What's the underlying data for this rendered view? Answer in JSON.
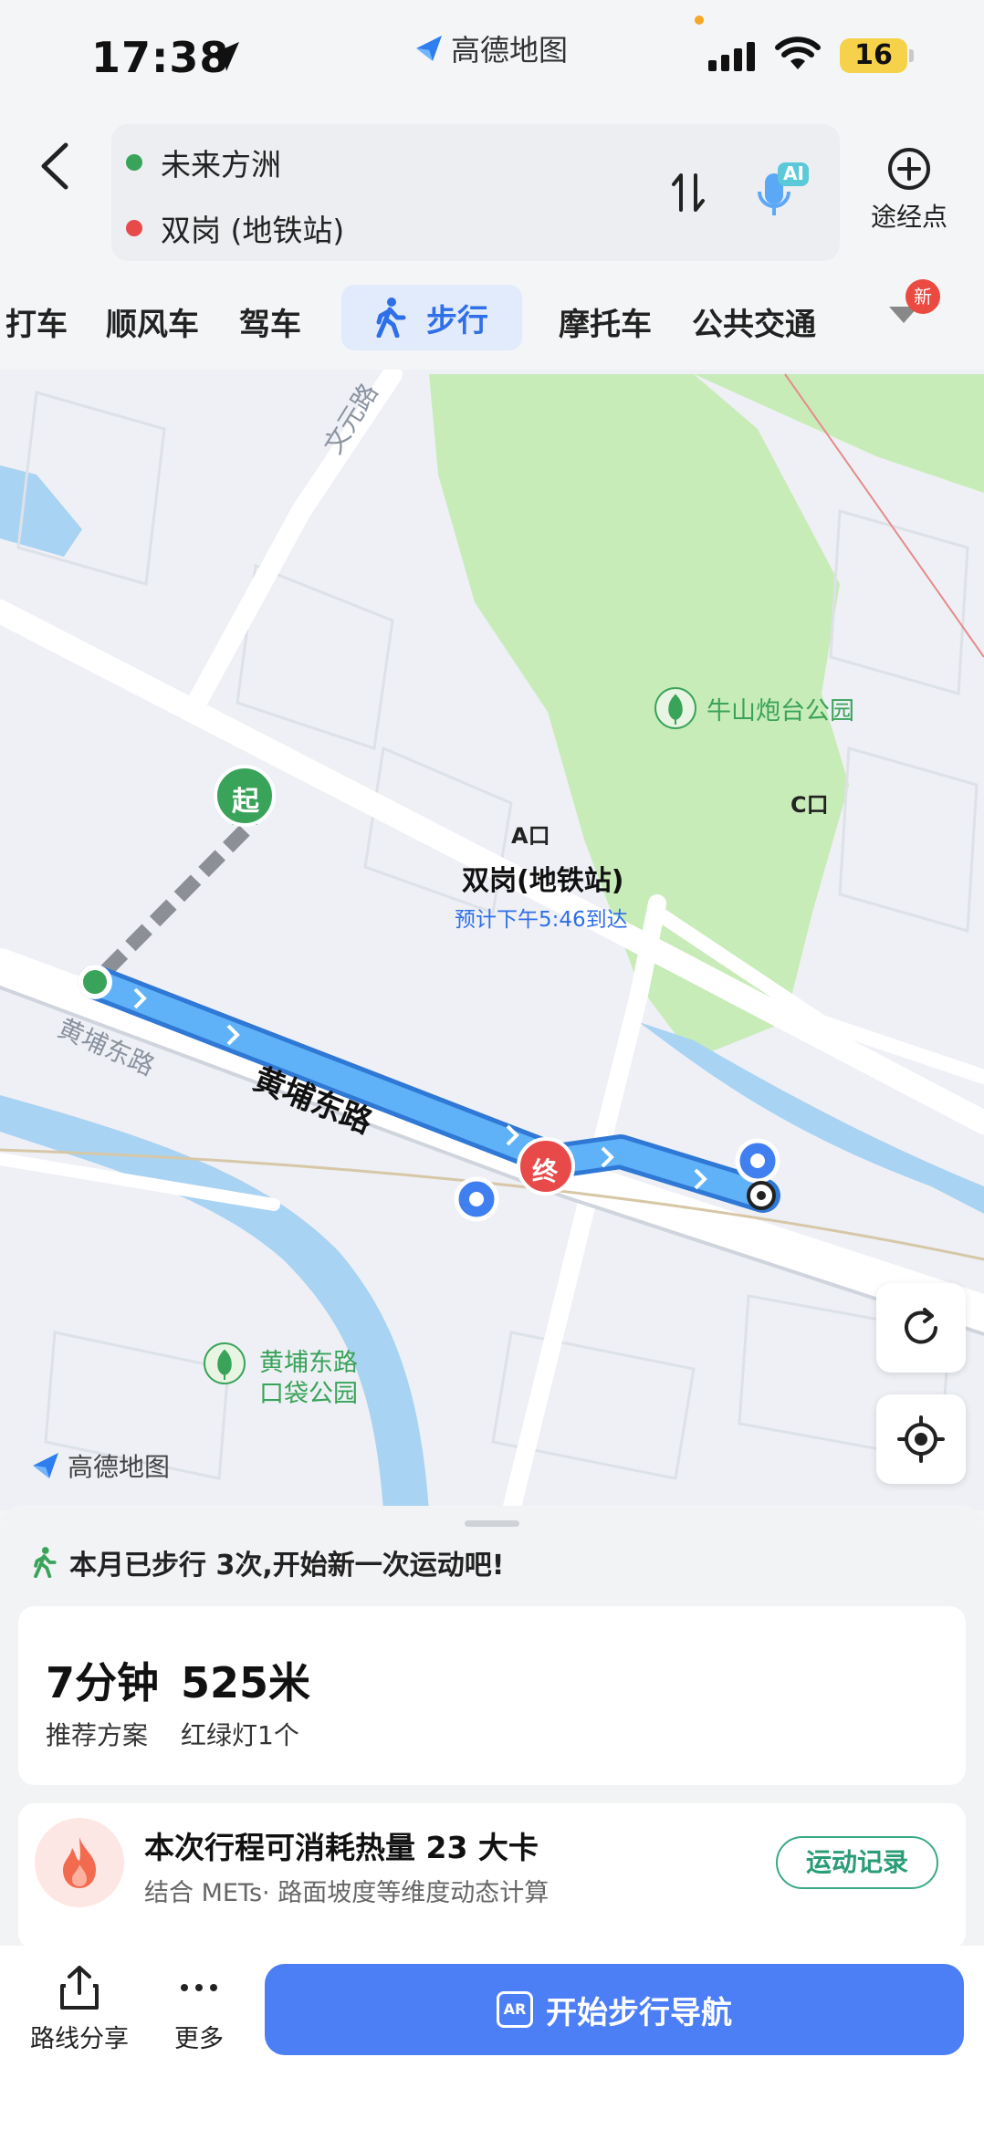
{
  "status_bar": {
    "time": "17:38",
    "app_name": "高德地图",
    "battery": "16"
  },
  "route": {
    "start": "未来方洲",
    "end": "双岗 (地铁站)",
    "ai_badge": "AI",
    "via_label": "途经点"
  },
  "tabs": {
    "items": [
      "打车",
      "顺风车",
      "驾车",
      "步行",
      "摩托车",
      "公共交通"
    ],
    "active": "步行",
    "new_badge": "新"
  },
  "map": {
    "road_wenyuan": "文元路",
    "road_huangpu_small": "黄埔东路",
    "road_huangpu_route": "黄埔东路",
    "park_niushan": "牛山炮台公园",
    "park_huangpu_1": "黄埔东路",
    "park_huangpu_2": "口袋公园",
    "start_marker": "起",
    "end_marker": "终",
    "exit_a": "A口",
    "exit_c": "C口",
    "station": "双岗(地铁站)",
    "eta": "预计下午5:46到达",
    "logo": "高德地图"
  },
  "summary": {
    "walk_tip": "本月已步行 3次,开始新一次运动吧!",
    "duration": "7分钟",
    "distance": "525米",
    "plan_label": "推荐方案",
    "lights_label": "红绿灯1个",
    "calorie_title": "本次行程可消耗热量 23 大卡",
    "calorie_sub": "结合 METs· 路面坡度等维度动态计算",
    "record_button": "运动记录"
  },
  "actions": {
    "share": "路线分享",
    "more": "更多",
    "start": "开始步行导航",
    "ar_badge": "AR"
  },
  "colors": {
    "accent": "#4c7ef5",
    "route_line": "#4a9cf0",
    "start_green": "#3aa35a",
    "end_red": "#e84a4a",
    "park_green": "#c8ecb8"
  }
}
